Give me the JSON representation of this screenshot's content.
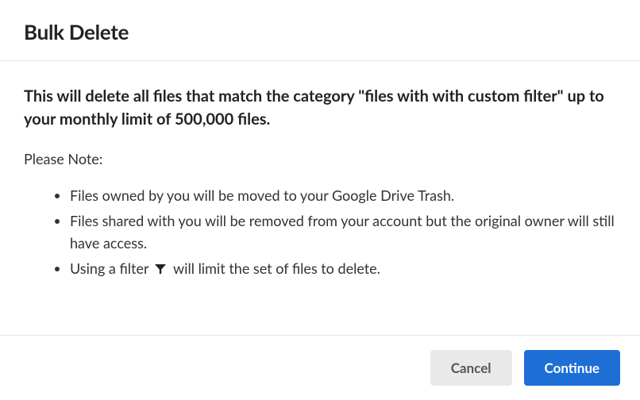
{
  "dialog": {
    "title": "Bulk Delete",
    "warning": "This will delete all files that match the category \"files with with custom filter\" up to your monthly limit of 500,000 files.",
    "note_label": "Please Note:",
    "notes": {
      "item1": "Files owned by you will be moved to your Google Drive Trash.",
      "item2": "Files shared with you will be removed from your account but the original owner will still have access.",
      "item3_prefix": "Using a filter",
      "item3_suffix": " will limit the set of files to delete."
    }
  },
  "buttons": {
    "cancel": "Cancel",
    "continue": "Continue"
  }
}
